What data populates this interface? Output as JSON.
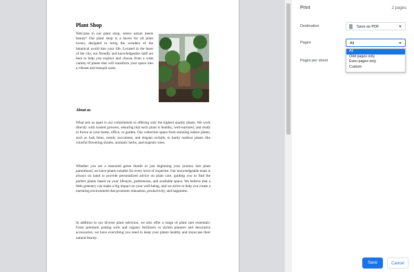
{
  "document": {
    "title": "Plant Shop",
    "intro": "Welcome to our plant shop, where nature meets beauty! Our plant shop is a haven for all plant lovers, designed to bring the wonders of the botanical world into your life. Located in the heart of the city, our friendly and knowledgeable staff are here to help you explore and choose from a wide variety of plants that will transform your space into a vibrant and tranquil oasis.",
    "about_heading": "About us",
    "paragraph1": "What sets us apart is our commitment to offering only the highest quality plants. We work directly with trusted growers, ensuring that each plant is healthy, well-nurtured, and ready to thrive in your home, office, or garden. Our collection spans from stunning indoor plants, such as lush ferns, trendy succulents, and elegant orchids, to hardy outdoor plants like colorful flowering shrubs, aromatic herbs, and majestic trees.",
    "paragraph2": "Whether you are a seasoned green thumb or just beginning your journey into plant parenthood, we have plants suitable for every level of expertise. Our knowledgeable team is always on hand to provide personalized advice on plant care, guiding you to find the perfect plants based on your lifestyle, preferences, and available space. We believe that a little greenery can make a big impact on your well-being, and we strive to help you create a nurturing environment that promotes relaxation, productivity, and happiness.",
    "paragraph3": "In addition to our diverse plant selection, we also offer a range of plant care essentials. From premium potting soils and organic fertilizers to stylish planters and decorative accessories, we have everything you need to keep your plants healthy and showcase their natural beauty."
  },
  "print_panel": {
    "title": "Print",
    "page_count": "2 pages",
    "destination_label": "Destination",
    "destination_value": "Save as PDF",
    "pages_label": "Pages",
    "pages_value": "All",
    "pages_options": [
      "All",
      "Odd pages only",
      "Even pages only",
      "Custom"
    ],
    "pages_per_sheet_label": "Pages per sheet",
    "save_label": "Save",
    "cancel_label": "Cancel"
  },
  "colors": {
    "accent": "#1a73e8",
    "preview_bg": "#dadce0"
  }
}
